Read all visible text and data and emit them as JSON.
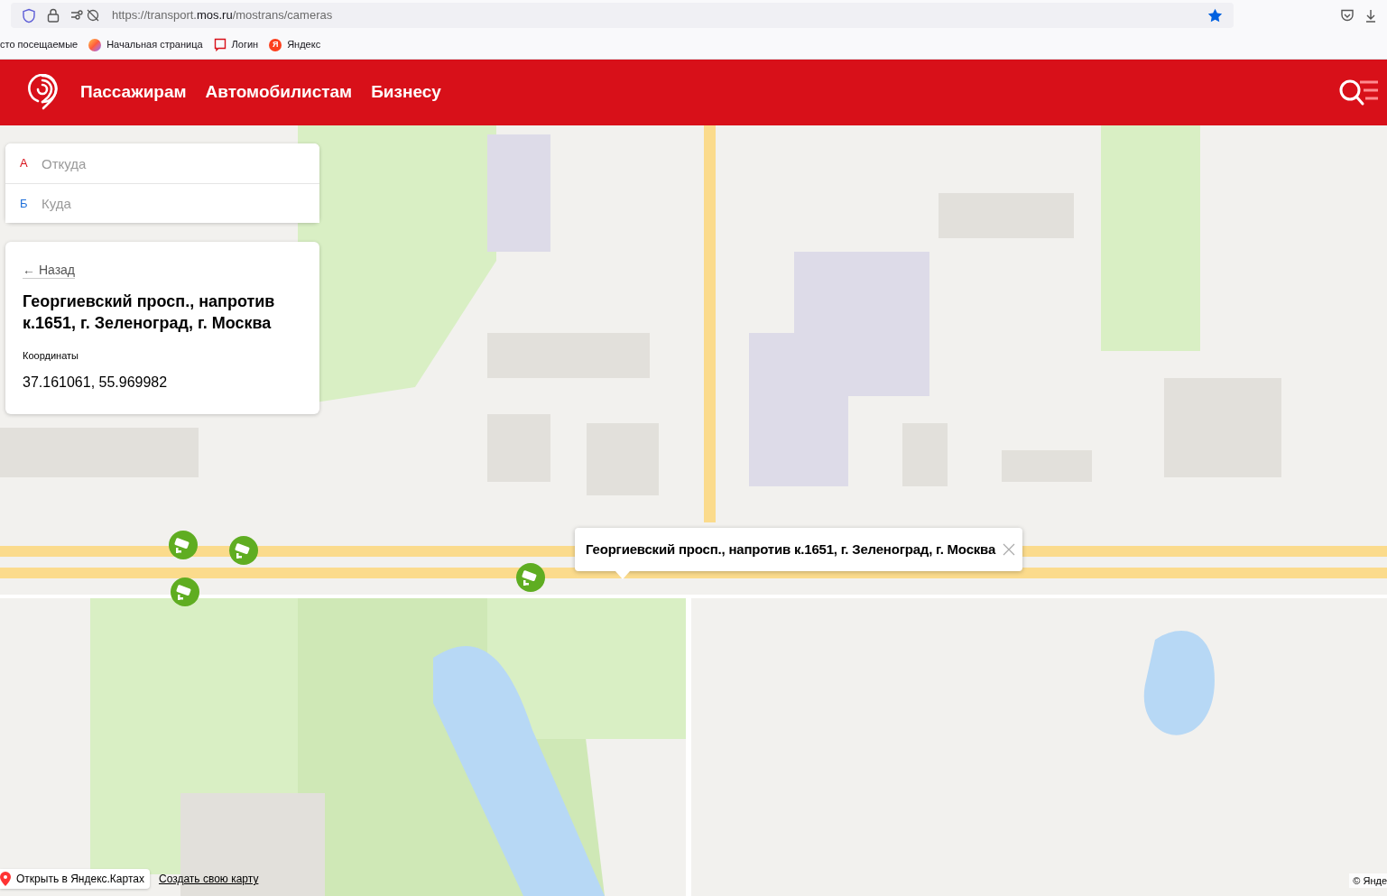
{
  "browser": {
    "url_prefix": "https://transport.",
    "url_domain": "mos.ru",
    "url_path": "/mostrans/cameras",
    "bookmarked": true,
    "bookmarks": [
      {
        "kind": "text",
        "label": "сто посещаемые"
      },
      {
        "kind": "browser",
        "label": "Начальная страница"
      },
      {
        "kind": "page",
        "label": "Логин"
      },
      {
        "kind": "yandex",
        "label": "Яндекс",
        "badge": "Я"
      }
    ]
  },
  "header": {
    "nav": [
      "Пассажирам",
      "Автомобилистам",
      "Бизнесу"
    ]
  },
  "route": [
    {
      "letter": "А",
      "placeholder": "Откуда",
      "color": "#d81019"
    },
    {
      "letter": "Б",
      "placeholder": "Куда",
      "color": "#1e6fd9"
    }
  ],
  "info": {
    "back": "← Назад",
    "title": "Георгиевский просп., напротив к.1651, г. Зеленоград, г. Москва",
    "coords_label": "Координаты",
    "coords": "37.161061, 55.969982"
  },
  "popup": {
    "text": "Георгиевский просп., напротив к.1651, г. Зеленоград, г. Москва"
  },
  "map_footer": {
    "open": "Открыть в Яндекс.Картах",
    "create": "Создать свою карту",
    "copyright": "© Янде"
  }
}
